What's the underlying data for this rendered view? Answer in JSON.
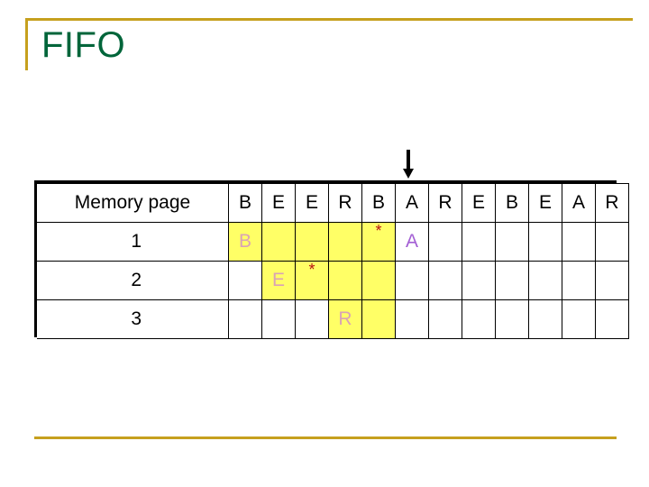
{
  "slide": {
    "title": "FIFO",
    "title_color": "#00653a",
    "rule_color": "#c6a01e"
  },
  "pointer": {
    "icon": "down-arrow-icon",
    "points_at_column_index": 5,
    "color": "#000000"
  },
  "table": {
    "label_header": "Memory page",
    "reference_string": [
      "B",
      "E",
      "E",
      "R",
      "B",
      "A",
      "R",
      "E",
      "B",
      "E",
      "A",
      "R"
    ],
    "highlight_color": "#ffff66",
    "resident_letter_color": "#d9a3b5",
    "new_letter_color": "#a35fd4",
    "fault_marker_color": "#b81414",
    "fault_marker": "*",
    "rows": [
      {
        "label": "1",
        "cells": [
          {
            "text": "B",
            "style": "resident",
            "highlight": true
          },
          {
            "text": "",
            "style": "blank",
            "highlight": true
          },
          {
            "text": "",
            "style": "blank",
            "highlight": true
          },
          {
            "text": "",
            "style": "blank",
            "highlight": true
          },
          {
            "text": "*",
            "style": "fault",
            "highlight": true
          },
          {
            "text": "A",
            "style": "new",
            "highlight": false
          },
          {
            "text": "",
            "style": "blank",
            "highlight": false
          },
          {
            "text": "",
            "style": "blank",
            "highlight": false
          },
          {
            "text": "",
            "style": "blank",
            "highlight": false
          },
          {
            "text": "",
            "style": "blank",
            "highlight": false
          },
          {
            "text": "",
            "style": "blank",
            "highlight": false
          },
          {
            "text": "",
            "style": "blank",
            "highlight": false
          }
        ]
      },
      {
        "label": "2",
        "cells": [
          {
            "text": "",
            "style": "blank",
            "highlight": false
          },
          {
            "text": "E",
            "style": "resident",
            "highlight": true
          },
          {
            "text": "*",
            "style": "fault",
            "highlight": true
          },
          {
            "text": "",
            "style": "blank",
            "highlight": true
          },
          {
            "text": "",
            "style": "blank",
            "highlight": true
          },
          {
            "text": "",
            "style": "blank",
            "highlight": false
          },
          {
            "text": "",
            "style": "blank",
            "highlight": false
          },
          {
            "text": "",
            "style": "blank",
            "highlight": false
          },
          {
            "text": "",
            "style": "blank",
            "highlight": false
          },
          {
            "text": "",
            "style": "blank",
            "highlight": false
          },
          {
            "text": "",
            "style": "blank",
            "highlight": false
          },
          {
            "text": "",
            "style": "blank",
            "highlight": false
          }
        ]
      },
      {
        "label": "3",
        "cells": [
          {
            "text": "",
            "style": "blank",
            "highlight": false
          },
          {
            "text": "",
            "style": "blank",
            "highlight": false
          },
          {
            "text": "",
            "style": "blank",
            "highlight": false
          },
          {
            "text": "R",
            "style": "resident",
            "highlight": true
          },
          {
            "text": "",
            "style": "blank",
            "highlight": true
          },
          {
            "text": "",
            "style": "blank",
            "highlight": false
          },
          {
            "text": "",
            "style": "blank",
            "highlight": false
          },
          {
            "text": "",
            "style": "blank",
            "highlight": false
          },
          {
            "text": "",
            "style": "blank",
            "highlight": false
          },
          {
            "text": "",
            "style": "blank",
            "highlight": false
          },
          {
            "text": "",
            "style": "blank",
            "highlight": false
          },
          {
            "text": "",
            "style": "blank",
            "highlight": false
          }
        ]
      }
    ]
  }
}
